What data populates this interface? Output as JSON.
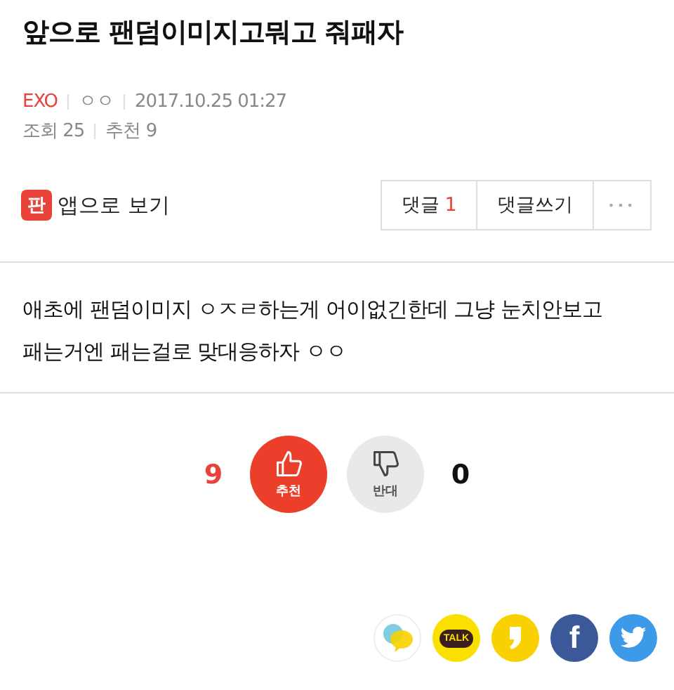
{
  "title": "앞으로 팬덤이미지고뭐고 줘패자",
  "meta": {
    "board": "EXO",
    "author": "ㅇㅇ",
    "date": "2017.10.25 01:27",
    "views": "조회 25",
    "recommends": "추천 9"
  },
  "app_link": {
    "badge": "판",
    "label": "앱으로 보기"
  },
  "actions": {
    "comments_label": "댓글",
    "comments_count": "1",
    "write": "댓글쓰기",
    "more": "•••"
  },
  "body": [
    "애초에 팬덤이미지 ㅇㅈㄹ하는게 어이없긴한데 그냥 눈치안보고",
    "패는거엔 패는걸로 맞대응하자 ㅇㅇ"
  ],
  "votes": {
    "up_count": "9",
    "up_label": "추천",
    "down_label": "반대",
    "down_count": "0"
  },
  "shares": [
    {
      "kind": "chat"
    },
    {
      "kind": "talk",
      "label": "TALK"
    },
    {
      "kind": "story"
    },
    {
      "kind": "facebook",
      "label": "f"
    },
    {
      "kind": "twitter"
    }
  ]
}
